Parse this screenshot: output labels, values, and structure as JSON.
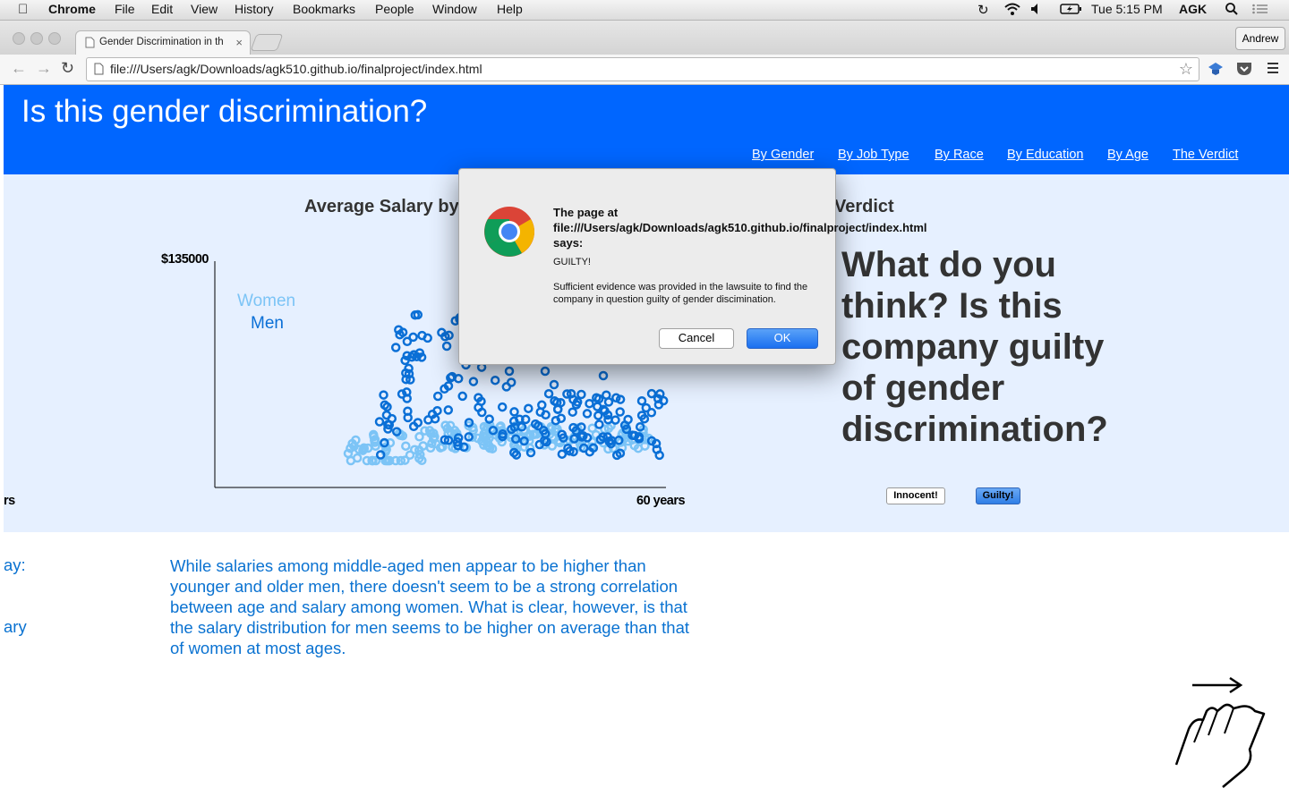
{
  "menubar": {
    "app": "Chrome",
    "items": [
      "File",
      "Edit",
      "View",
      "History",
      "Bookmarks",
      "People",
      "Window",
      "Help"
    ],
    "clock": "Tue 5:15 PM",
    "user": "AGK"
  },
  "browser": {
    "tab_title": "Gender Discrimination in th",
    "profile": "Andrew",
    "url": "file:///Users/agk/Downloads/agk510.github.io/finalproject/index.html"
  },
  "header": {
    "title": "Is this gender discrimination?",
    "nav": [
      "By Gender",
      "By Job Type",
      "By Race",
      "By Education",
      "By Age",
      "The Verdict"
    ]
  },
  "viz": {
    "chart_title_left": "Average Salary by",
    "chart_title_right": "Verdict",
    "y_max_label": "$135000",
    "x_left_label": "rs",
    "x_max_label": "60 years",
    "legend": [
      "Women",
      "Men"
    ]
  },
  "verdict": {
    "question": "What do you think? Is this company guilty of gender discrimination?",
    "innocent_label": "Innocent!",
    "guilty_label": "Guilty!"
  },
  "lower": {
    "side_label_1": "ay:",
    "side_label_2": "ary",
    "narrative": "While salaries among middle-aged men appear to be higher than younger and older men, there doesn't seem to be a strong correlation between age and salary among women. What is clear, however, is that the salary distribution for men seems to be higher on average than that of women at most ages."
  },
  "dialog": {
    "header": "The page at file:///Users/agk/Downloads/agk510.github.io/finalproject/index.html says:",
    "verdict": "GUILTY!",
    "detail": "Sufficient evidence was provided in the lawsuite to find the company in question guilty of gender discimination.",
    "cancel": "Cancel",
    "ok": "OK"
  },
  "colors": {
    "header_bg": "#0066ff",
    "viz_bg": "#e6f0ff",
    "men": "#0a6fd6",
    "women": "#7cc4f6",
    "narrative": "#0a72d1"
  }
}
